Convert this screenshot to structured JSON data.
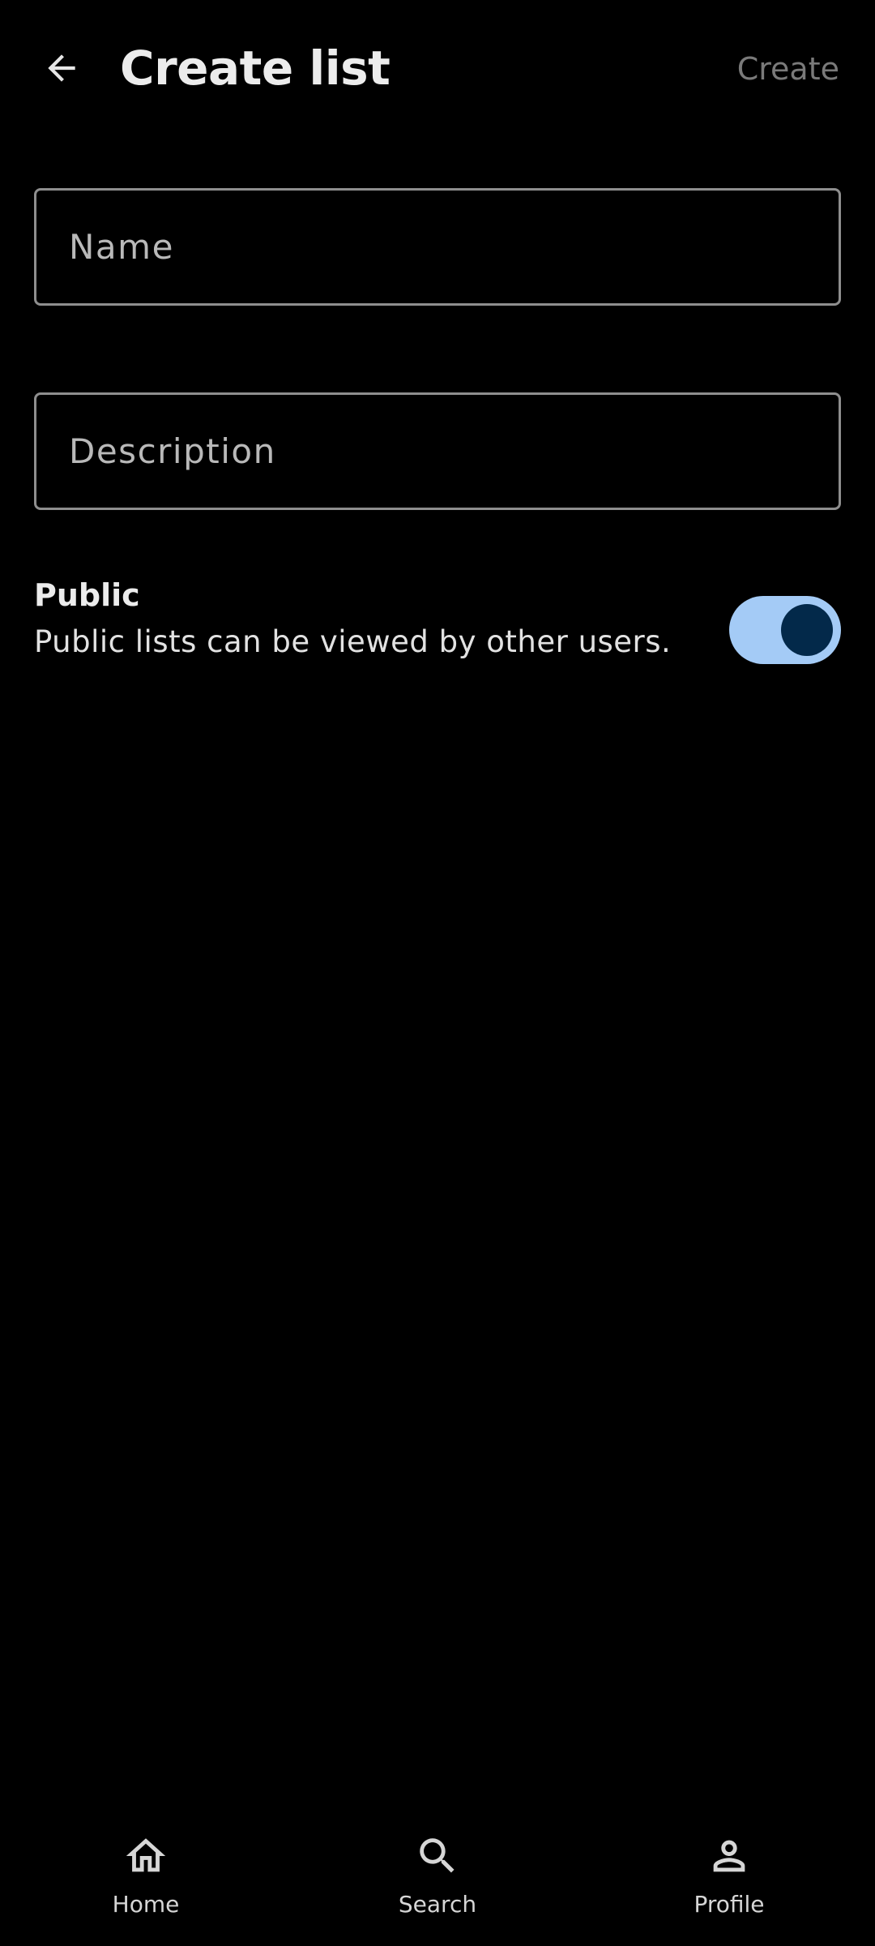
{
  "header": {
    "back_icon": "arrow-left-icon",
    "title": "Create list",
    "action_label": "Create"
  },
  "form": {
    "name_placeholder": "Name",
    "name_value": "",
    "description_placeholder": "Description",
    "description_value": ""
  },
  "public_toggle": {
    "title": "Public",
    "description": "Public lists can be viewed by other users.",
    "enabled": true,
    "track_color": "#A4CBF6",
    "thumb_color": "#03294A"
  },
  "bottom_nav": {
    "items": [
      {
        "label": "Home",
        "icon": "home-icon"
      },
      {
        "label": "Search",
        "icon": "search-icon"
      },
      {
        "label": "Profile",
        "icon": "person-icon"
      }
    ]
  },
  "colors": {
    "background": "#000000",
    "text_primary": "#ECECEC",
    "text_disabled": "#7A7A7A",
    "field_border": "#8E8E8E"
  }
}
